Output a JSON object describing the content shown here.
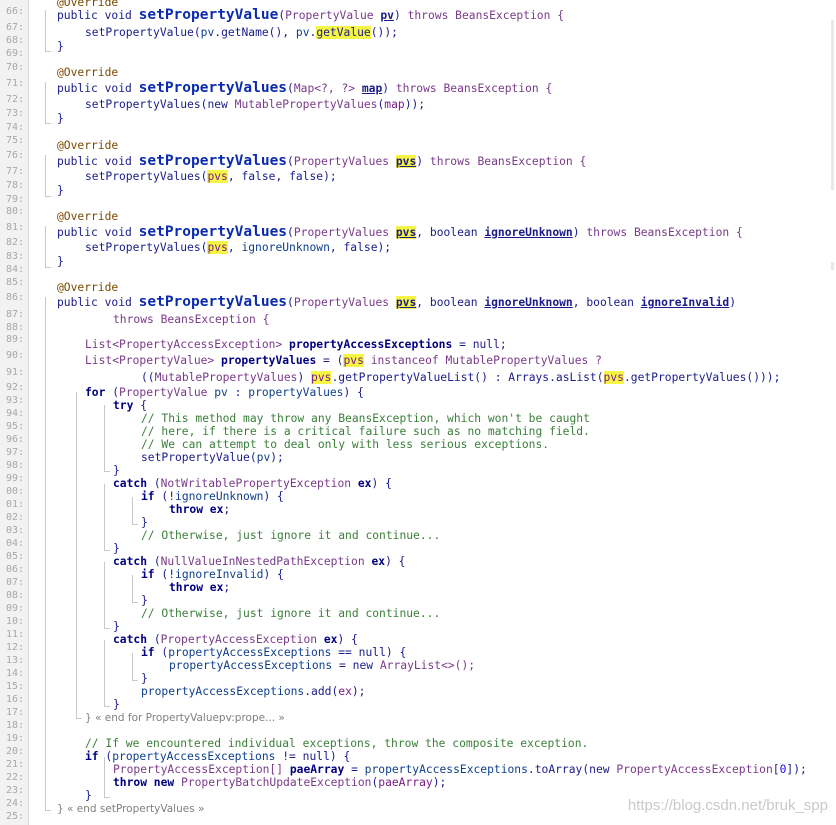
{
  "editor": {
    "line_numbers": [
      "66:",
      "67:",
      "68:",
      "69:",
      "70:",
      "71:",
      "72:",
      "73:",
      "74:",
      "75:",
      "76:",
      "77:",
      "78:",
      "79:",
      "80:",
      "81:",
      "82:",
      "83:",
      "84:",
      "85:",
      "86:",
      "87:",
      "88:",
      "89:",
      "90:",
      "91:",
      "92:",
      "93:",
      "94:",
      "95:",
      "96:",
      "97:",
      "98:",
      "99:",
      "00:",
      "01:",
      "02:",
      "03:",
      "04:",
      "05:",
      "06:",
      "07:",
      "08:",
      "09:",
      "10:",
      "11:",
      "12:",
      "13:",
      "14:",
      "15:",
      "16:",
      "17:",
      "18:",
      "19:",
      "20:",
      "21:",
      "22:",
      "23:",
      "24:",
      "25:"
    ],
    "fold_labels": {
      "for_end": "} « end for PropertyValuepv:prope... »",
      "method_end": "} « end setPropertyValues »"
    },
    "watermark": "https://blog.csdn.net/bruk_spp",
    "highlight_color": "#f5f545"
  }
}
